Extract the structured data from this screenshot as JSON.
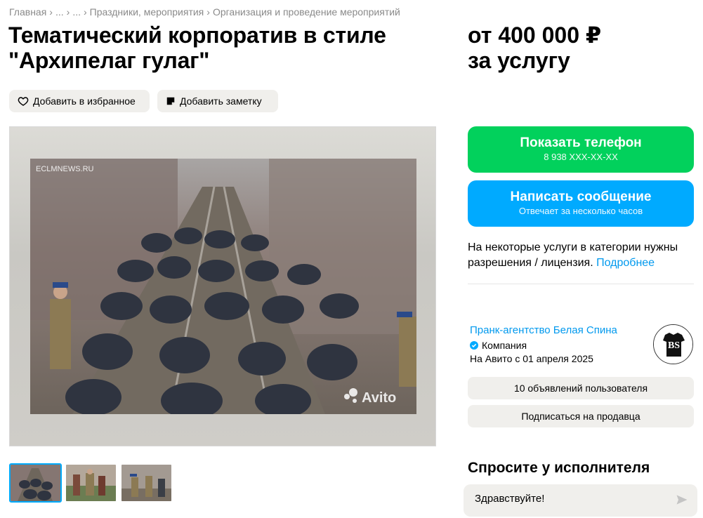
{
  "breadcrumb": {
    "items": [
      "Главная",
      "...",
      "...",
      "Праздники, мероприятия",
      "Организация и проведение мероприятий"
    ],
    "separator": "›"
  },
  "listing": {
    "title": "Тематический корпоратив в стиле \"Архипелаг гулаг\"",
    "price": "от 400 000 ₽",
    "price_unit": "за услугу"
  },
  "actions": {
    "favorite": "Добавить в избранное",
    "note": "Добавить заметку"
  },
  "gallery": {
    "watermark_top": "ECLMNEWS.RU",
    "watermark_brand": "Avito",
    "thumb_count": 3
  },
  "contact": {
    "phone_label": "Показать телефон",
    "phone_masked": "8 938 XXX-XX-XX",
    "message_label": "Написать сообщение",
    "message_sub": "Отвечает за несколько часов"
  },
  "license": {
    "text": "На некоторые услуги в категории нужны разрешения / лицензия.",
    "link": "Подробнее"
  },
  "seller": {
    "name": "Пранк-агентство Белая Спина",
    "type": "Компания",
    "since": "На Авито с 01 апреля 2025",
    "avatar_text": "BS",
    "ads_count": "10 объявлений пользователя",
    "subscribe": "Подписаться на продавца"
  },
  "ask": {
    "title": "Спросите у исполнителя",
    "input_value": "Здравствуйте!"
  },
  "colors": {
    "green": "#02d15c",
    "blue": "#00aaff",
    "link": "#0099ee",
    "pill": "#f0efec"
  }
}
